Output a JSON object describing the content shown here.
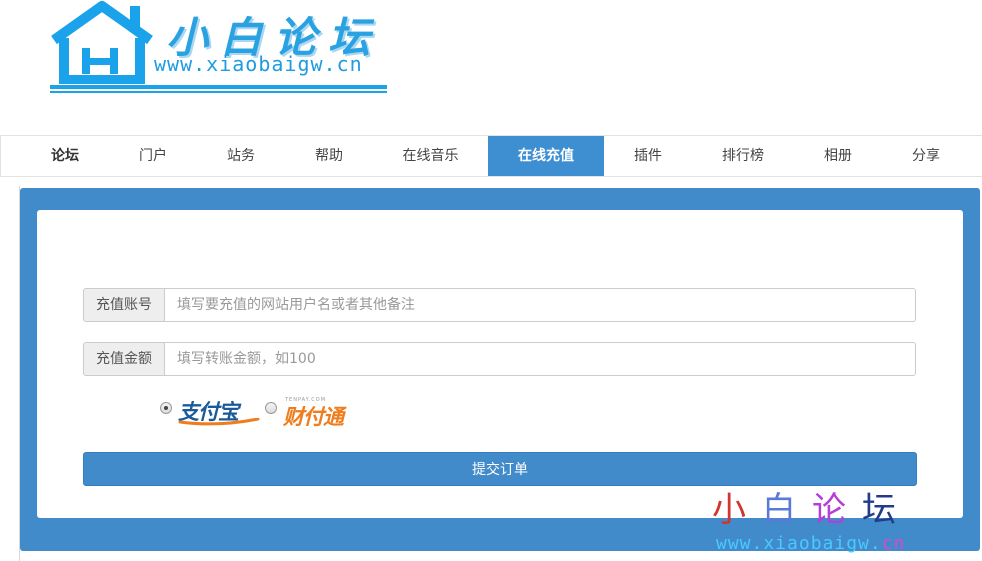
{
  "logo": {
    "title": "小白论坛",
    "url": "www.xiaobaigw.cn"
  },
  "nav": {
    "items": [
      "论坛",
      "门户",
      "站务",
      "帮助",
      "在线音乐",
      "在线充值",
      "插件",
      "排行榜",
      "相册",
      "分享"
    ],
    "active": "在线充值"
  },
  "form": {
    "account_label": "充值账号",
    "account_placeholder": "填写要充值的网站用户名或者其他备注",
    "amount_label": "充值金额",
    "amount_placeholder": "填写转账金额，如100",
    "payment": {
      "selected": "alipay",
      "alipay_label": "支付宝",
      "tenpay_label": "财付通",
      "tenpay_small": "TENPAY.COM"
    },
    "submit_label": "提交订单"
  },
  "watermark": {
    "title": "小白论坛",
    "url": "www.xiaobaigw.cn"
  },
  "colors": {
    "accent": "#428bca",
    "nav_active": "#3d8fd1",
    "logo_blue": "#1aa3ea",
    "tenpay_orange": "#ef7d1d"
  }
}
